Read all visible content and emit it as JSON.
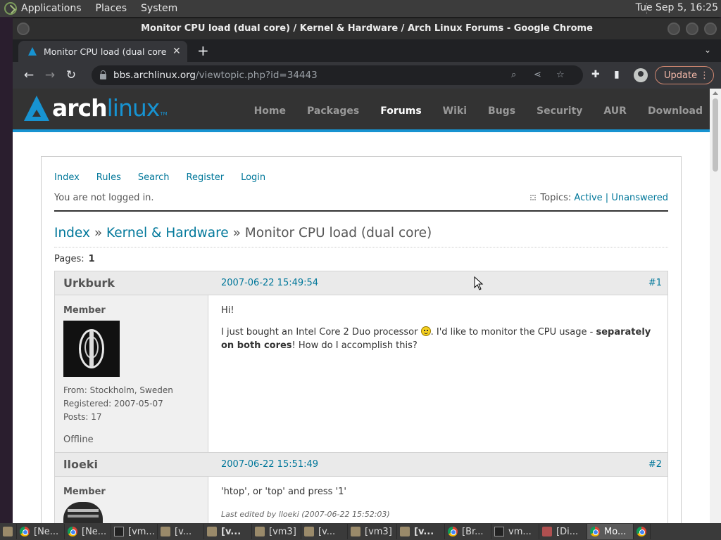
{
  "system_panel": {
    "menus": [
      "Applications",
      "Places",
      "System"
    ],
    "clock": "Tue Sep  5, 16:25"
  },
  "window": {
    "title": "Monitor CPU load (dual core) / Kernel & Hardware / Arch Linux Forums - Google Chrome"
  },
  "browser": {
    "tab_title": "Monitor CPU load (dual core) / Kernel & Hardware / Arch Linux Forums",
    "url_host": "bbs.archlinux.org",
    "url_path": "/viewtopic.php?id=34443",
    "update_label": "Update"
  },
  "site": {
    "logo_arch": "arch",
    "logo_linux": "linux",
    "logo_tm": "TM",
    "nav": [
      "Home",
      "Packages",
      "Forums",
      "Wiki",
      "Bugs",
      "Security",
      "AUR",
      "Download"
    ],
    "active_nav": "Forums"
  },
  "forum": {
    "menu": [
      "Index",
      "Rules",
      "Search",
      "Register",
      "Login"
    ],
    "not_logged_in": "You are not logged in.",
    "topics_label": "Topics:",
    "topics_active": "Active",
    "topics_sep": "|",
    "topics_unanswered": "Unanswered",
    "crumb_index": "Index",
    "crumb_sep": "»",
    "crumb_forum": "Kernel & Hardware",
    "crumb_topic": "Monitor CPU load (dual core)",
    "pages_label": "Pages:",
    "pages_current": "1"
  },
  "posts": [
    {
      "author": "Urkburk",
      "date": "2007-06-22 15:49:54",
      "num": "#1",
      "rank": "Member",
      "from": "From: Stockholm, Sweden",
      "registered": "Registered: 2007-05-07",
      "posts": "Posts: 17",
      "status": "Offline",
      "line1": "Hi!",
      "line2_a": "I just bought an Intel Core 2 Duo processor ",
      "line2_b": ". I'd like to monitor the CPU usage - ",
      "line2_bold": "separately on both cores",
      "line2_c": "! How do I accomplish this?"
    },
    {
      "author": "lloeki",
      "date": "2007-06-22 15:51:49",
      "num": "#2",
      "rank": "Member",
      "line1": "'htop', or 'top' and press '1'",
      "edited": "Last edited by lloeki (2007-06-22 15:52:03)"
    }
  ],
  "taskbar": [
    {
      "icon": "chrome",
      "label": "[Ne..."
    },
    {
      "icon": "chrome",
      "label": "[Ne..."
    },
    {
      "icon": "term",
      "label": "[vm..."
    },
    {
      "icon": "folder",
      "label": "[v..."
    },
    {
      "icon": "folder",
      "label": "[v...",
      "bold": true
    },
    {
      "icon": "folder",
      "label": "[vm3]"
    },
    {
      "icon": "folder",
      "label": "[v..."
    },
    {
      "icon": "folder",
      "label": "[vm3]"
    },
    {
      "icon": "folder",
      "label": "[v...",
      "bold": true
    },
    {
      "icon": "chrome",
      "label": "[Br..."
    },
    {
      "icon": "term",
      "label": "vm..."
    },
    {
      "icon": "app",
      "label": "[Di..."
    },
    {
      "icon": "chrome",
      "label": "Mo...",
      "active": true
    },
    {
      "icon": "chrome",
      "label": ""
    }
  ]
}
